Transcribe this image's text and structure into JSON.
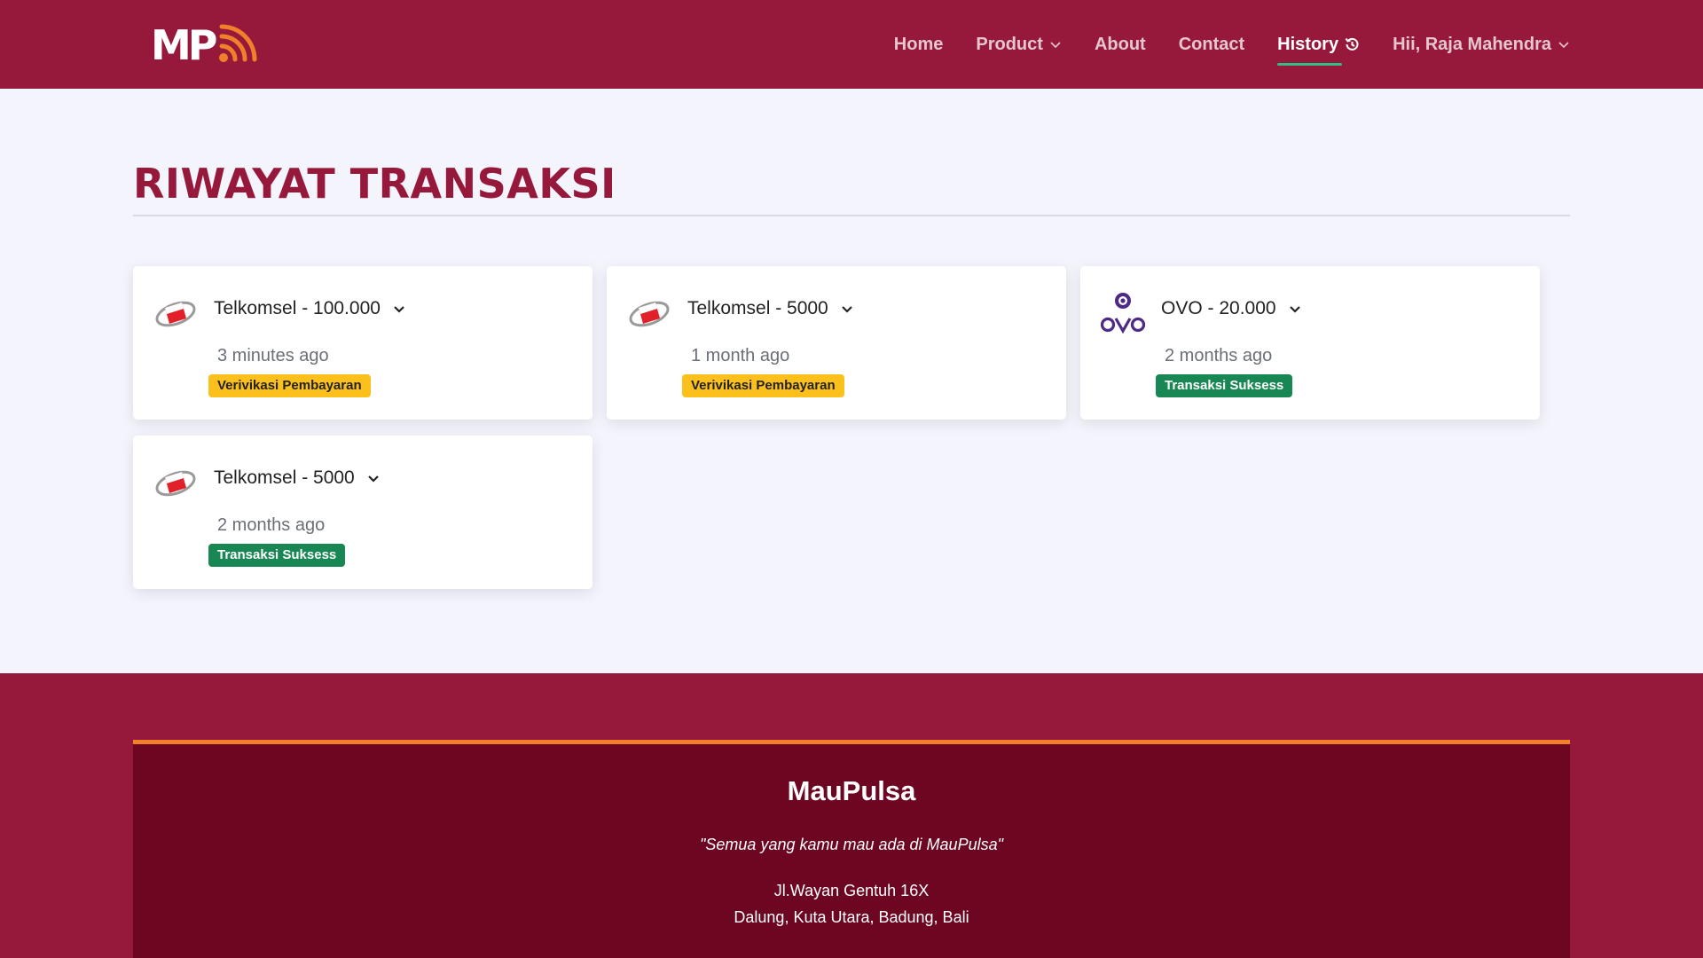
{
  "brand": {
    "logo_text": "MP"
  },
  "nav": {
    "items": [
      {
        "label": "Home"
      },
      {
        "label": "Product"
      },
      {
        "label": "About"
      },
      {
        "label": "Contact"
      },
      {
        "label": "History"
      },
      {
        "label": "Hii, Raja Mahendra"
      }
    ],
    "active": "History"
  },
  "page": {
    "title": "RIWAYAT TRANSAKSI"
  },
  "transactions": [
    {
      "title": "Telkomsel - 100.000",
      "time": "3 minutes ago",
      "status": "Verivikasi Pembayaran",
      "provider": "telkomsel"
    },
    {
      "title": "Telkomsel - 5000",
      "time": "1 month ago",
      "status": "Verivikasi Pembayaran",
      "provider": "telkomsel"
    },
    {
      "title": "OVO - 20.000",
      "time": "2 months ago",
      "status": "Transaksi Suksess",
      "provider": "ovo"
    },
    {
      "title": "Telkomsel - 5000",
      "time": "2 months ago",
      "status": "Transaksi Suksess",
      "provider": "telkomsel"
    }
  ],
  "colors": {
    "primary": "#96193c",
    "footer_dark": "#6d0621",
    "accent_orange": "#f0802a",
    "nav_active_underline": "#2fbf84",
    "badge_warning": "#fcc01d",
    "badge_success": "#198753"
  },
  "footer": {
    "brand": "MauPulsa",
    "tagline": "\"Semua yang kamu mau ada di MauPulsa\"",
    "address_line1": "Jl.Wayan Gentuh 16X",
    "address_line2": "Dalung, Kuta Utara, Badung, Bali"
  }
}
